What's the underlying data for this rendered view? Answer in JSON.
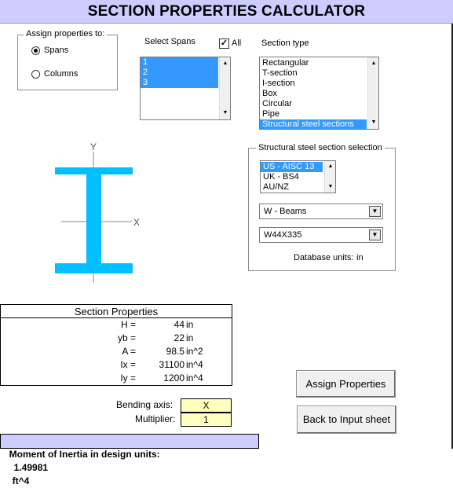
{
  "title": "SECTION PROPERTIES CALCULATOR",
  "assign_group": {
    "legend": "Assign properties to:",
    "options": [
      {
        "label": "Spans",
        "selected": true
      },
      {
        "label": "Columns",
        "selected": false
      }
    ]
  },
  "spans": {
    "label": "Select Spans",
    "all_label": "All",
    "all_checked": true,
    "items": [
      "1",
      "2",
      "3"
    ],
    "selected": [
      "1",
      "2",
      "3"
    ]
  },
  "section_type": {
    "label": "Section type",
    "items": [
      "Rectangular",
      "T-section",
      "I-section",
      "Box",
      "Circular",
      "Pipe",
      "Structural steel sections"
    ],
    "selected": "Structural steel sections"
  },
  "steel_selection": {
    "legend": "Structural steel section selection",
    "standards": [
      "US - AISC 13",
      "UK - BS4",
      "AU/NZ"
    ],
    "selected_standard": "US - AISC 13",
    "shape_type": "W - Beams",
    "section": "W44X335",
    "database_units_label": "Database units:",
    "database_units": "in"
  },
  "diagram": {
    "y_axis_label": "Y",
    "x_axis_label": "X",
    "section_color": "#00bfff"
  },
  "section_properties": {
    "heading": "Section Properties",
    "rows": [
      {
        "name": "H =",
        "value": "44",
        "unit": "in"
      },
      {
        "name": "yb =",
        "value": "22",
        "unit": "in"
      },
      {
        "name": "A =",
        "value": "98.5",
        "unit": "in^2"
      },
      {
        "name": "Ix =",
        "value": "31100",
        "unit": "in^4"
      },
      {
        "name": "Iy =",
        "value": "1200",
        "unit": "in^4"
      }
    ]
  },
  "bending": {
    "axis_label": "Bending axis:",
    "axis_value": "X",
    "multiplier_label": "Multiplier:",
    "multiplier_value": "1"
  },
  "buttons": {
    "assign": "Assign Properties",
    "back": "Back to Input sheet"
  },
  "status": {
    "moment_label": "Moment of Inertia in design units:",
    "moment_value": "1.49981",
    "moment_unit": "ft^4"
  },
  "colors": {
    "title_bg": "#ccccff",
    "selection": "#3399ff",
    "input_yellow": "#ffffc0"
  }
}
